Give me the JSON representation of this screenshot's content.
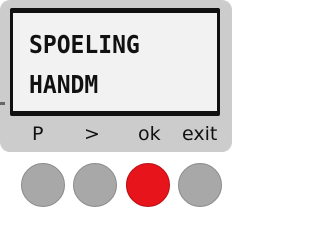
{
  "display": {
    "line1": "SPOELING",
    "line2": "HANDM"
  },
  "softkeys": {
    "p": "P",
    "next": ">",
    "ok": "ok",
    "exit": "exit"
  },
  "buttons": [
    {
      "name": "P",
      "color": "#a8a8a8"
    },
    {
      "name": ">",
      "color": "#a8a8a8"
    },
    {
      "name": "ok",
      "color": "#e8141b"
    },
    {
      "name": "exit",
      "color": "#a8a8a8"
    }
  ],
  "colors": {
    "panel": "#cccccc",
    "screen_bezel": "#111111",
    "lcd": "#f2f2f2",
    "accent": "#e8141b"
  }
}
